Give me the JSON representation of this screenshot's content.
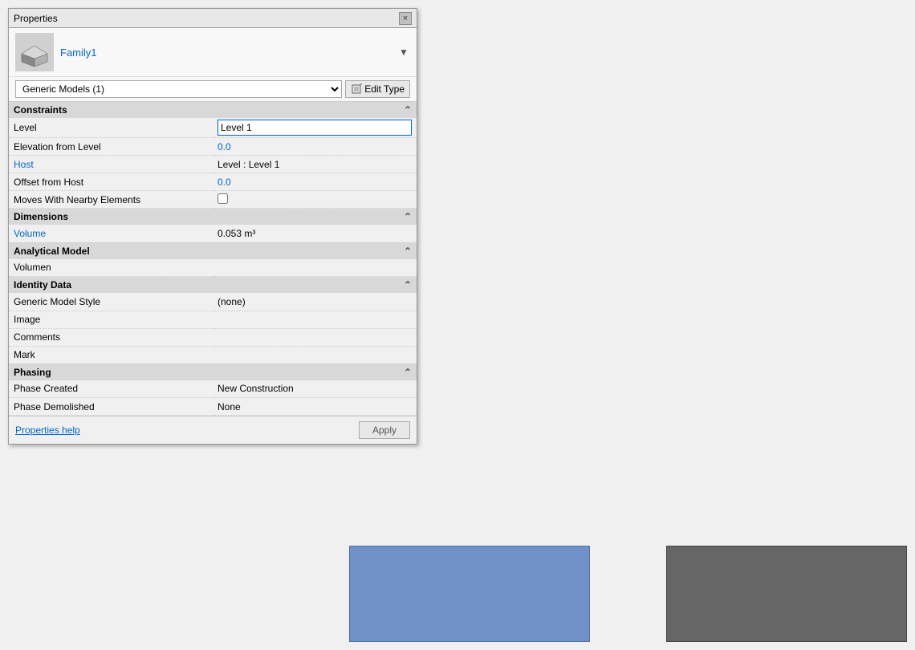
{
  "panel": {
    "title": "Properties",
    "close_label": "×"
  },
  "family": {
    "name": "Family1",
    "dropdown_char": "▼"
  },
  "type_selector": {
    "value": "Generic Models (1)",
    "edit_type_label": "Edit Type"
  },
  "sections": [
    {
      "id": "constraints",
      "label": "Constraints",
      "collapse_char": "⌃",
      "properties": [
        {
          "label": "Level",
          "value": "Level 1",
          "type": "input",
          "label_color": "normal"
        },
        {
          "label": "Elevation from Level",
          "value": "0.0",
          "type": "text",
          "label_color": "normal",
          "value_color": "blue"
        },
        {
          "label": "Host",
          "value": "Level : Level 1",
          "type": "text",
          "label_color": "blue",
          "value_color": "normal"
        },
        {
          "label": "Offset from Host",
          "value": "0.0",
          "type": "text",
          "label_color": "normal",
          "value_color": "blue"
        },
        {
          "label": "Moves With Nearby Elements",
          "value": "",
          "type": "checkbox",
          "label_color": "normal"
        }
      ]
    },
    {
      "id": "dimensions",
      "label": "Dimensions",
      "collapse_char": "⌃",
      "properties": [
        {
          "label": "Volume",
          "value": "0.053 m³",
          "type": "text",
          "label_color": "blue",
          "value_color": "normal"
        }
      ]
    },
    {
      "id": "analytical_model",
      "label": "Analytical Model",
      "collapse_char": "⌃",
      "properties": [
        {
          "label": "Volumen",
          "value": "",
          "type": "text",
          "label_color": "normal"
        }
      ]
    },
    {
      "id": "identity_data",
      "label": "Identity Data",
      "collapse_char": "⌃",
      "properties": [
        {
          "label": "Generic Model Style",
          "value": "(none)",
          "type": "text",
          "label_color": "normal"
        },
        {
          "label": "Image",
          "value": "",
          "type": "text",
          "label_color": "normal"
        },
        {
          "label": "Comments",
          "value": "",
          "type": "text",
          "label_color": "normal"
        },
        {
          "label": "Mark",
          "value": "",
          "type": "text",
          "label_color": "normal"
        }
      ]
    },
    {
      "id": "phasing",
      "label": "Phasing",
      "collapse_char": "⌃",
      "properties": [
        {
          "label": "Phase Created",
          "value": "New Construction",
          "type": "text",
          "label_color": "normal"
        },
        {
          "label": "Phase Demolished",
          "value": "None",
          "type": "text",
          "label_color": "normal"
        }
      ]
    }
  ],
  "footer": {
    "help_link": "Properties help",
    "apply_button": "Apply"
  },
  "bottom_rects": {
    "blue_color": "#7090c8",
    "dark_color": "#666666"
  }
}
